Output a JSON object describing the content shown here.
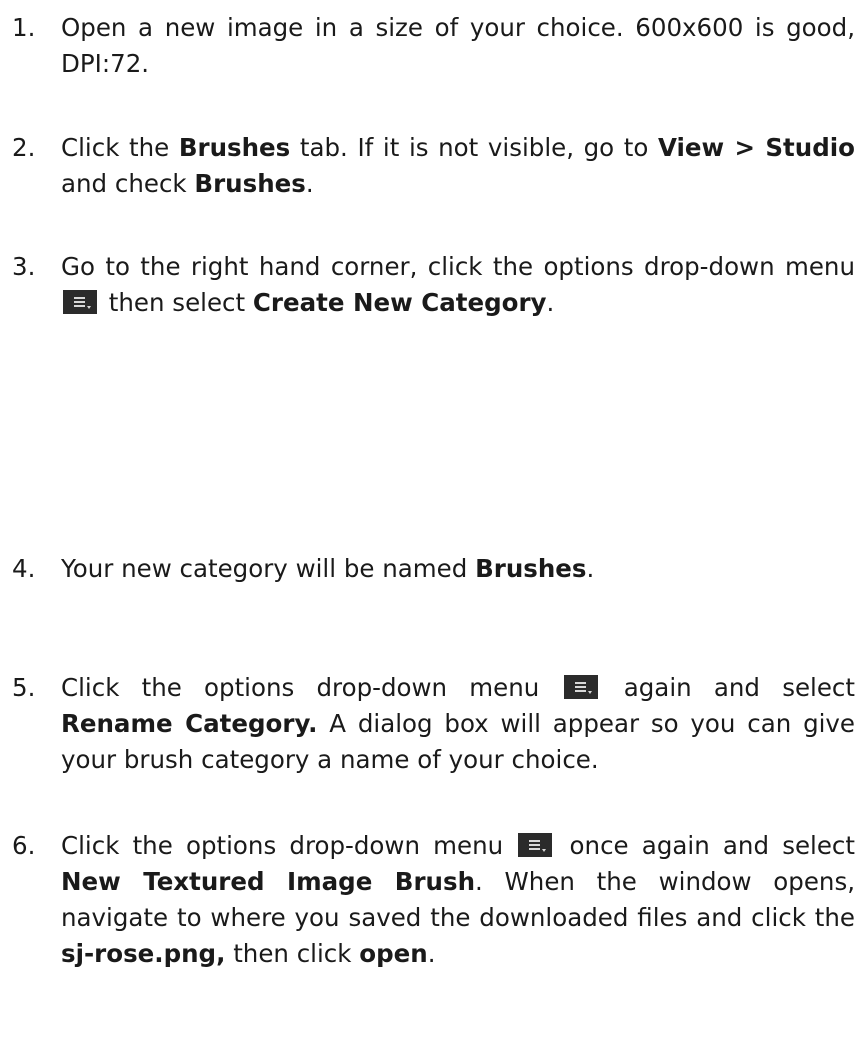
{
  "steps": [
    {
      "num": "1.",
      "parts": [
        "Open a new image in a size of your choice.  600x600 is good, DPI:72."
      ]
    },
    {
      "num": "2.",
      "parts": [
        "Click the ",
        "Brushes",
        " tab.  If it is not visible,  go to ",
        "View > Studio",
        " and check ",
        "Brushes",
        "."
      ]
    },
    {
      "num": "3.",
      "parts": [
        "Go to the right hand corner, click the options drop-down menu ",
        " then select ",
        "Create New Category",
        "."
      ]
    },
    {
      "num": "4.",
      "parts": [
        "Your new category will be named ",
        "Brushes",
        "."
      ]
    },
    {
      "num": "5.",
      "parts": [
        "Click the options drop-down menu ",
        " again and select ",
        "Rename Category.",
        "  A dialog box will appear so you can give your brush category a name of your choice."
      ]
    },
    {
      "num": "6.",
      "parts": [
        "Click the options drop-down menu ",
        " once again and select ",
        "New Textured Image Brush",
        ".  When the window opens, navigate to where you saved the downloaded files and click the ",
        "sj-rose.png,",
        " then click ",
        "open",
        "."
      ]
    }
  ],
  "icons": {
    "options_menu": "options-dropdown-menu-icon"
  }
}
